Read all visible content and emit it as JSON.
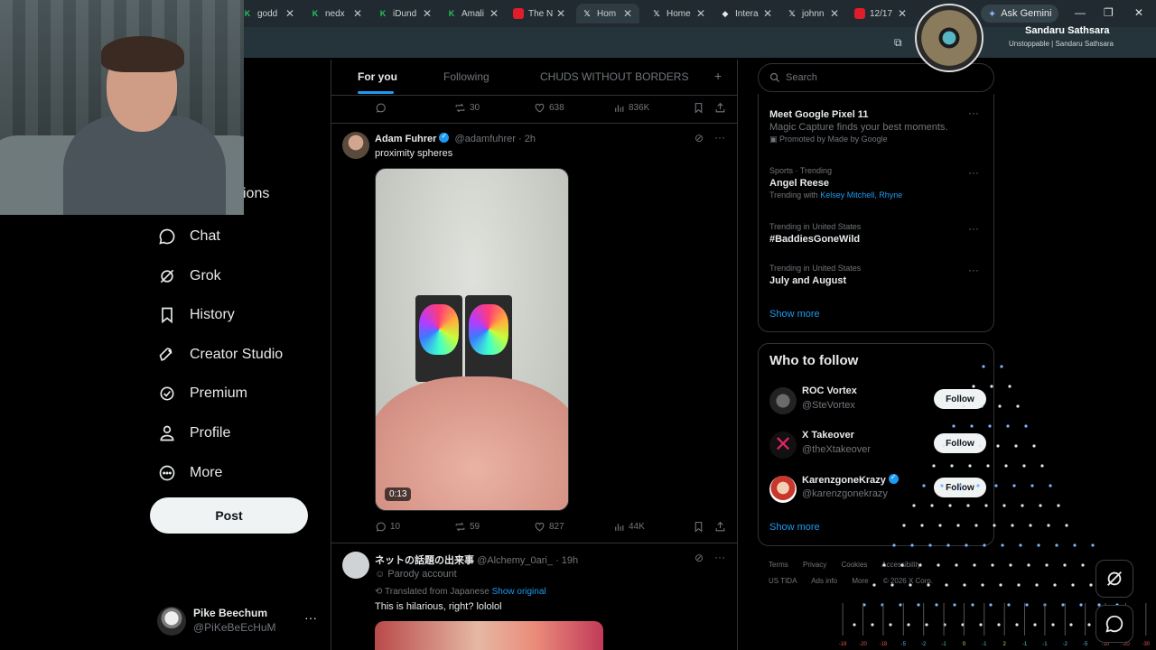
{
  "browser": {
    "tabs": [
      {
        "title": "godd",
        "icon": "k-icon"
      },
      {
        "title": "nedx",
        "icon": "k-icon"
      },
      {
        "title": "iDund",
        "icon": "k-icon"
      },
      {
        "title": "Amali",
        "icon": "k-icon"
      },
      {
        "title": "The N",
        "icon": "youtube-icon"
      },
      {
        "title": "Hom",
        "icon": "x-icon",
        "active": true
      },
      {
        "title": "Home",
        "icon": "x-icon"
      },
      {
        "title": "Intera",
        "icon": "diamond-icon"
      },
      {
        "title": "johnn",
        "icon": "x-icon"
      },
      {
        "title": "12/17",
        "icon": "youtube-icon"
      }
    ],
    "ask_gemini": "Ask Gemini"
  },
  "streamer": {
    "name": "Sandaru Sathsara",
    "subtitle": "Unstoppable | Sandaru Sathsara"
  },
  "nav": {
    "partial_label": "ions",
    "items": [
      {
        "label": "Chat",
        "icon": "chat-bubble-icon"
      },
      {
        "label": "Grok",
        "icon": "grok-icon"
      },
      {
        "label": "History",
        "icon": "bookmark-icon"
      },
      {
        "label": "Creator Studio",
        "icon": "rocket-icon"
      },
      {
        "label": "Premium",
        "icon": "verified-badge-icon"
      },
      {
        "label": "Profile",
        "icon": "person-icon"
      },
      {
        "label": "More",
        "icon": "more-circle-icon"
      }
    ],
    "post_label": "Post",
    "account": {
      "name": "Pike Beechum",
      "handle": "@PiKeBeEcHuM",
      "more": "···"
    }
  },
  "timeline": {
    "tabs": [
      "For you",
      "Following",
      "CHUDS WITHOUT BORDERS"
    ],
    "add_tab": "+",
    "prev_actions": {
      "replies": "",
      "reposts": "30",
      "likes": "638",
      "views": "836K"
    },
    "tweets": [
      {
        "name": "Adam Fuhrer",
        "handle": "@adamfuhrer",
        "time": "· 2h",
        "text": "proximity spheres",
        "duration": "0:13",
        "replies": "10",
        "reposts": "59",
        "likes": "827",
        "views": "44K"
      },
      {
        "name": "ネットの話題の出来事",
        "handle": "@Alchemy_0ari_",
        "time": "· 19h",
        "badge": "Parody account",
        "translated": "Translated from Japanese",
        "show_original": "Show original",
        "text": "This is hilarious, right? lololol"
      }
    ]
  },
  "sidebar": {
    "search_placeholder": "Search",
    "trends": [
      {
        "context": "",
        "title": "Meet Google Pixel 11",
        "sub": "Magic Capture finds your best moments.",
        "promo": "Promoted by Made by Google"
      },
      {
        "context": "Sports · Trending",
        "title": "Angel Reese",
        "trending_with_label": "Trending with",
        "trending_with": "Kelsey Mitchell, Rhyne"
      },
      {
        "context": "Trending in United States",
        "title": "#BaddiesGoneWild"
      },
      {
        "context": "Trending in United States",
        "title": "July and August"
      }
    ],
    "show_more": "Show more",
    "who_to_follow": {
      "title": "Who to follow",
      "accounts": [
        {
          "name": "ROC Vortex",
          "handle": "@SteVortex",
          "button": "Follow"
        },
        {
          "name": "X Takeover",
          "handle": "@theXtakeover",
          "button": "Follow"
        },
        {
          "name": "KarenzgoneKrazy",
          "handle": "@karenzgonekrazy",
          "button": "Follow",
          "verified": true
        }
      ],
      "show_more": "Show more"
    },
    "footer": [
      "Terms",
      "Privacy",
      "Cookies",
      "Accessibility",
      "US TIDA",
      "Ads info",
      "More",
      "© 2026 X Corp."
    ]
  },
  "meter_labels": [
    "-18",
    "-20",
    "-18",
    "-5",
    "-2",
    "-1",
    "0",
    "-1",
    "2",
    "-1",
    "-1",
    "-2",
    "-5",
    "-10",
    "-20",
    "-30"
  ],
  "colors": {
    "accent": "#1d9bf0",
    "bg": "#000000",
    "border": "#2f3336",
    "muted": "#71767b"
  }
}
